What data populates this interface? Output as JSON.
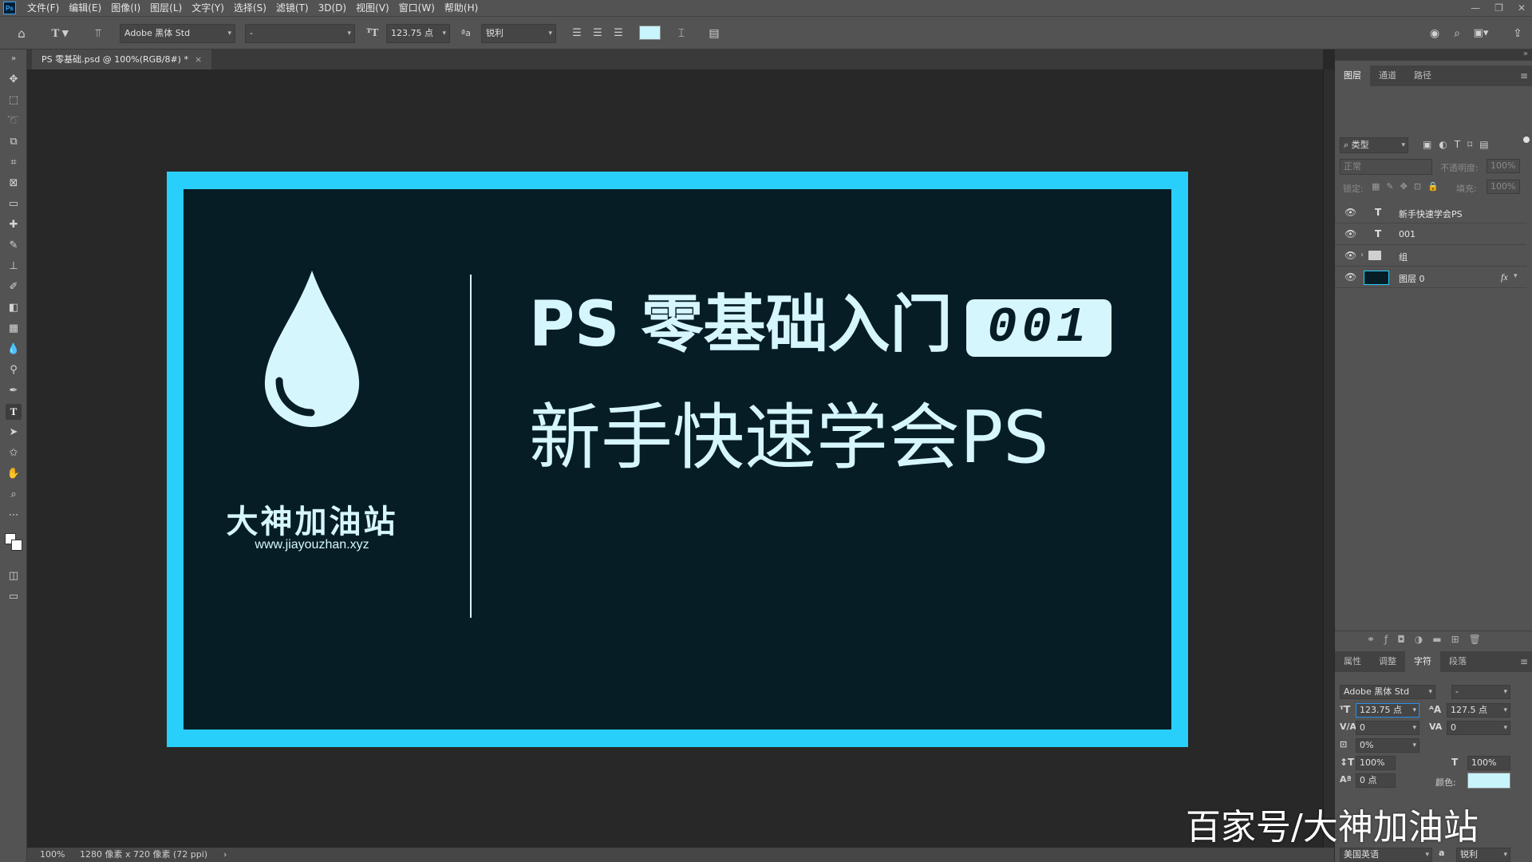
{
  "app": {
    "menu": [
      "文件(F)",
      "编辑(E)",
      "图像(I)",
      "图层(L)",
      "文字(Y)",
      "选择(S)",
      "滤镜(T)",
      "3D(D)",
      "视图(V)",
      "窗口(W)",
      "帮助(H)"
    ],
    "logo": "Ps"
  },
  "options": {
    "font_family": "Adobe 黑体 Std",
    "font_style": "-",
    "font_size": "123.75 点",
    "antialias": "锐利",
    "text_color": "#c8f4fc"
  },
  "document": {
    "tab_title": "PS 零基础.psd @ 100%(RGB/8#) *",
    "tab_close": "×"
  },
  "artwork": {
    "brand_name": "大神加油站",
    "brand_url": "www.jiayouzhan.xyz",
    "title_line": "PS 零基础入门",
    "badge_number": "001",
    "subtitle_line": "新手快速学会PS",
    "border_color": "#29cffb",
    "bg_color": "#071d26",
    "text_color": "#d6f6fd"
  },
  "status": {
    "zoom": "100%",
    "doc_info": "1280 像素 x 720 像素 (72 ppi)",
    "arrow": "›"
  },
  "layers_panel": {
    "tabs": [
      "图层",
      "通道",
      "路径"
    ],
    "filter_label": "类型",
    "blend_mode": "正常",
    "opacity_label": "不透明度:",
    "opacity_value": "100%",
    "lock_label": "锁定:",
    "fill_label": "填充:",
    "fill_value": "100%",
    "layers": [
      {
        "type_icon": "T",
        "name": "新手快速学会PS"
      },
      {
        "type_icon": "T",
        "name": "001"
      },
      {
        "type_icon": "folder",
        "name": "组"
      },
      {
        "type_icon": "thumb",
        "name": "图层 0",
        "fx": "fx"
      }
    ]
  },
  "character_panel": {
    "tabs": [
      "属性",
      "调整",
      "字符",
      "段落"
    ],
    "font_family": "Adobe 黑体 Std",
    "font_style": "-",
    "size": "123.75 点",
    "leading": "127.5 点",
    "kerning": "0",
    "tracking": "0",
    "scale_pct": "0%",
    "vscale": "100%",
    "hscale": "100%",
    "baseline": "0 点",
    "color_label": "颜色:",
    "color": "#c8f4fc",
    "language": "美国英语",
    "aa_label": "a",
    "antialias": "锐利"
  },
  "watermark": "百家号/大神加油站"
}
